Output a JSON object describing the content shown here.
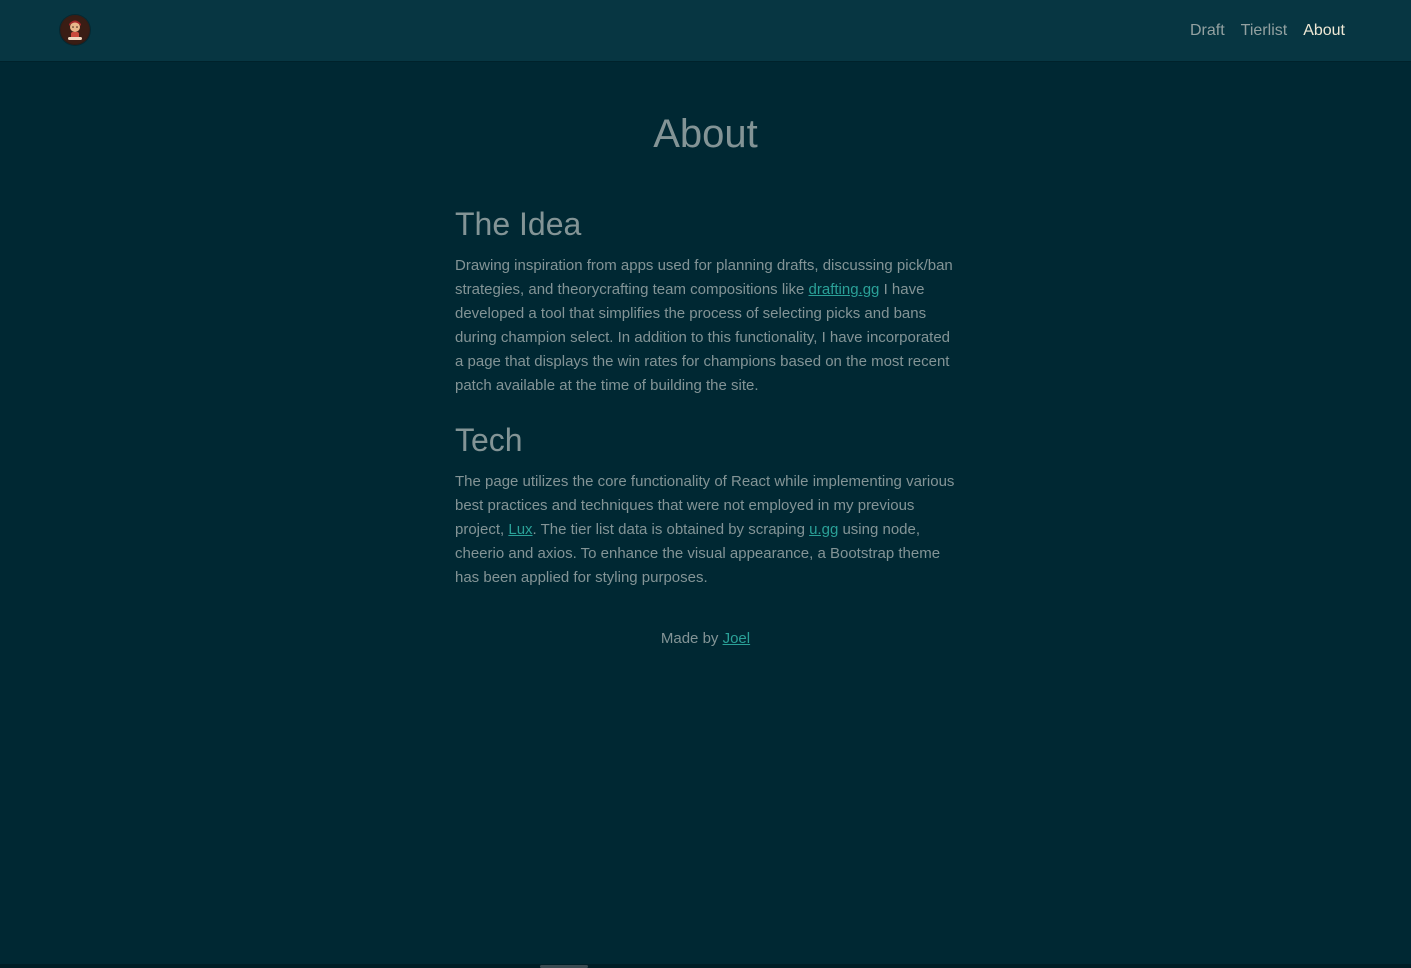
{
  "header": {
    "logo_icon": "avatar-logo-icon",
    "nav": [
      {
        "label": "Draft",
        "active": false
      },
      {
        "label": "Tierlist",
        "active": false
      },
      {
        "label": "About",
        "active": true
      }
    ]
  },
  "page": {
    "title": "About",
    "sections": [
      {
        "heading": "The Idea",
        "text_before": "Drawing inspiration from apps used for planning drafts, discussing pick/ban strategies, and theorycrafting team compositions like ",
        "link": "drafting.gg",
        "text_after": " I have developed a tool that simplifies the process of selecting picks and bans during champion select. In addition to this functionality, I have incorporated a page that displays the win rates for champions based on the most recent patch available at the time of building the site."
      },
      {
        "heading": "Tech",
        "text_part1": "The page utilizes the core functionality of React while implementing various best practices and techniques that were not employed in my previous project, ",
        "link1": "Lux",
        "text_part2": ". The tier list data is obtained by scraping ",
        "link2": "u.gg",
        "text_part3": " using node, cheerio and axios. To enhance the visual appearance, a Bootstrap theme has been applied for styling purposes."
      }
    ],
    "footer": {
      "prefix": "Made by ",
      "author": "Joel"
    }
  },
  "colors": {
    "background": "#002833",
    "navbar": "#073642",
    "text": "#839496",
    "link": "#2aa198",
    "active_nav": "#eee8d5"
  }
}
